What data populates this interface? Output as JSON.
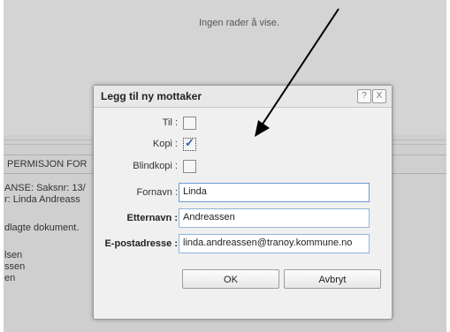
{
  "background": {
    "notice": "Ingen rader å vise.",
    "letter_title": "PERMISJON FOR",
    "letter_lines": [
      "ANSE: Saksnr: 13/",
      "r: Linda  Andreass",
      "",
      "dlagte dokument.",
      "",
      "lsen",
      "ssen",
      "en"
    ]
  },
  "dialog": {
    "title": "Legg til ny mottaker",
    "help_symbol": "?",
    "close_symbol": "X",
    "fields": {
      "til_label": "Til :",
      "kopi_label": "Kopi :",
      "kopi_check": "✓",
      "blindkopi_label": "Blindkopi :",
      "fornavn_label": "Fornavn :",
      "fornavn_value": "Linda",
      "etternavn_label": "Etternavn :",
      "etternavn_value": "Andreassen",
      "epost_label": "E-postadresse :",
      "epost_value": "linda.andreassen@tranoy.kommune.no"
    },
    "ok_label": "OK",
    "cancel_label": "Avbryt"
  },
  "annotation": {
    "color": "#000000"
  }
}
